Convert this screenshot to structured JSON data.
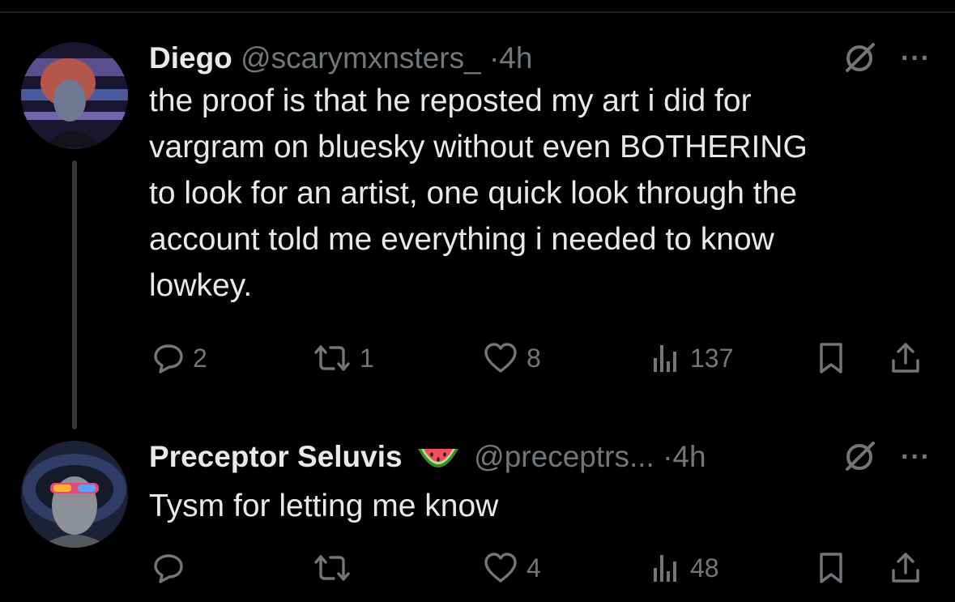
{
  "tweets": [
    {
      "display_name": "Diego",
      "handle": "@scarymxnsters_",
      "separator": "·",
      "time": "4h",
      "text": "the proof is that he reposted my art i did for\nvargram on bluesky without even BOTHERING\nto look for an artist, one quick look through the\naccount told me everything i needed to know\nlowkey.",
      "replies": "2",
      "reposts": "1",
      "likes": "8",
      "views": "137",
      "more_label": "···"
    },
    {
      "display_name": "Preceptor Seluvis",
      "name_emoji": "watermelon-icon",
      "handle": "@preceptrs...",
      "separator": "·",
      "time": "4h",
      "text": "Tysm for letting me know",
      "replies": "",
      "reposts": "",
      "likes": "4",
      "views": "48",
      "more_label": "···"
    }
  ],
  "colors": {
    "background": "#000000",
    "text": "#e7e9ea",
    "muted": "#71767b",
    "thread_line": "#333639"
  }
}
